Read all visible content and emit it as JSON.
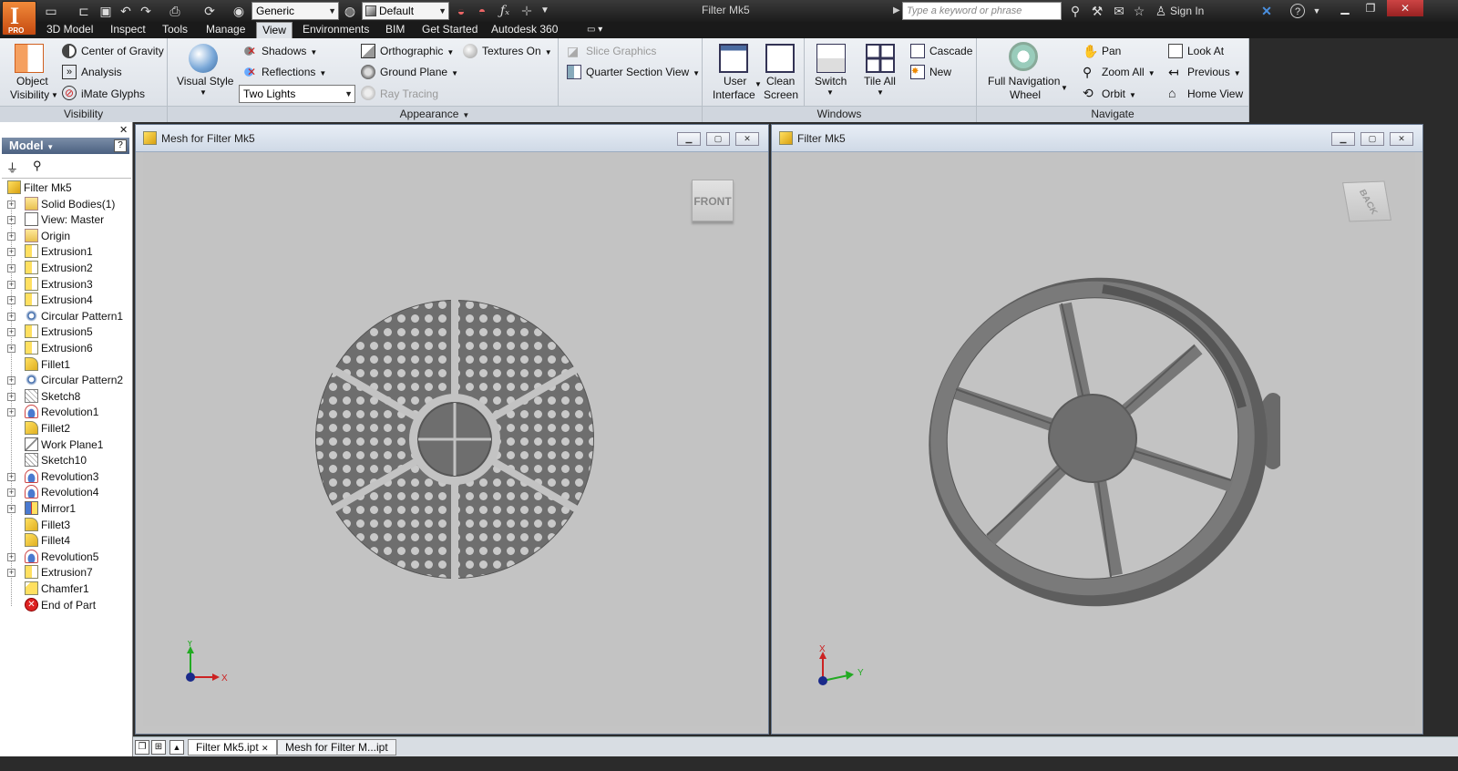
{
  "app": {
    "edition": "PRO",
    "logo_letter": "I"
  },
  "quick_access": {
    "appearance_combo": "Generic",
    "material_combo": "Default"
  },
  "title": "Filter Mk5",
  "search": {
    "placeholder": "Type a keyword or phrase"
  },
  "sign_in": "Sign In",
  "menu_tabs": [
    {
      "label": "3D Model"
    },
    {
      "label": "Inspect"
    },
    {
      "label": "Tools"
    },
    {
      "label": "Manage"
    },
    {
      "label": "View",
      "active": true
    },
    {
      "label": "Environments"
    },
    {
      "label": "BIM"
    },
    {
      "label": "Get Started"
    },
    {
      "label": "Autodesk 360"
    }
  ],
  "ribbon": {
    "visibility": {
      "object_visibility_1": "Object",
      "object_visibility_2": "Visibility",
      "center_of_gravity": "Center of Gravity",
      "analysis": "Analysis",
      "imate_glyphs": "iMate Glyphs",
      "label": "Visibility"
    },
    "appearance": {
      "visual_style": "Visual Style",
      "shadows": "Shadows",
      "reflections": "Reflections",
      "lighting": "Two Lights",
      "orthographic": "Orthographic",
      "ground_plane": "Ground Plane",
      "ray_tracing": "Ray Tracing",
      "textures_on": "Textures On",
      "slice_graphics": "Slice Graphics",
      "quarter_section_view": "Quarter Section View",
      "label": "Appearance"
    },
    "windows": {
      "user_interface_1": "User",
      "user_interface_2": "Interface",
      "clean_screen_1": "Clean",
      "clean_screen_2": "Screen",
      "switch": "Switch",
      "tile_all": "Tile All",
      "cascade": "Cascade",
      "new": "New",
      "label": "Windows"
    },
    "navigate": {
      "full_nav_1": "Full Navigation",
      "full_nav_2": "Wheel",
      "pan": "Pan",
      "zoom_all": "Zoom All",
      "orbit": "Orbit",
      "look_at": "Look At",
      "previous": "Previous",
      "home_view": "Home View",
      "label": "Navigate"
    }
  },
  "browser": {
    "header": "Model",
    "items": [
      {
        "label": "Filter Mk5",
        "icon": "part",
        "root": true
      },
      {
        "label": "Solid Bodies(1)",
        "icon": "folder"
      },
      {
        "label": "View: Master",
        "icon": "view"
      },
      {
        "label": "Origin",
        "icon": "folder"
      },
      {
        "label": "Extrusion1",
        "icon": "extrude"
      },
      {
        "label": "Extrusion2",
        "icon": "extrude"
      },
      {
        "label": "Extrusion3",
        "icon": "extrude"
      },
      {
        "label": "Extrusion4",
        "icon": "extrude"
      },
      {
        "label": "Circular Pattern1",
        "icon": "pattern"
      },
      {
        "label": "Extrusion5",
        "icon": "extrude"
      },
      {
        "label": "Extrusion6",
        "icon": "extrude"
      },
      {
        "label": "Fillet1",
        "icon": "fillet",
        "leaf": true
      },
      {
        "label": "Circular Pattern2",
        "icon": "pattern"
      },
      {
        "label": "Sketch8",
        "icon": "sketch"
      },
      {
        "label": "Revolution1",
        "icon": "revolve"
      },
      {
        "label": "Fillet2",
        "icon": "fillet",
        "leaf": true
      },
      {
        "label": "Work Plane1",
        "icon": "workplane",
        "leaf": true
      },
      {
        "label": "Sketch10",
        "icon": "sketch",
        "leaf": true
      },
      {
        "label": "Revolution3",
        "icon": "revolve"
      },
      {
        "label": "Revolution4",
        "icon": "revolve"
      },
      {
        "label": "Mirror1",
        "icon": "mirror"
      },
      {
        "label": "Fillet3",
        "icon": "fillet",
        "leaf": true
      },
      {
        "label": "Fillet4",
        "icon": "fillet",
        "leaf": true
      },
      {
        "label": "Revolution5",
        "icon": "revolve"
      },
      {
        "label": "Extrusion7",
        "icon": "extrude"
      },
      {
        "label": "Chamfer1",
        "icon": "chamfer",
        "leaf": true
      },
      {
        "label": "End of Part",
        "icon": "end",
        "leaf": true
      }
    ]
  },
  "viewports": {
    "left": {
      "title": "Mesh for Filter Mk5",
      "viewcube": "FRONT",
      "axis_x": "X",
      "axis_y": "Y"
    },
    "right": {
      "title": "Filter Mk5",
      "viewcube": "BACK",
      "axis_x": "X",
      "axis_y": "Y"
    }
  },
  "doc_tabs": [
    {
      "label": "Filter Mk5.ipt",
      "active": true
    },
    {
      "label": "Mesh for Filter M...ipt"
    }
  ],
  "colors": {
    "accent": "#e8792a",
    "model_gray": "#6e6e6e",
    "viewport_bg": "#c3c3c3"
  }
}
